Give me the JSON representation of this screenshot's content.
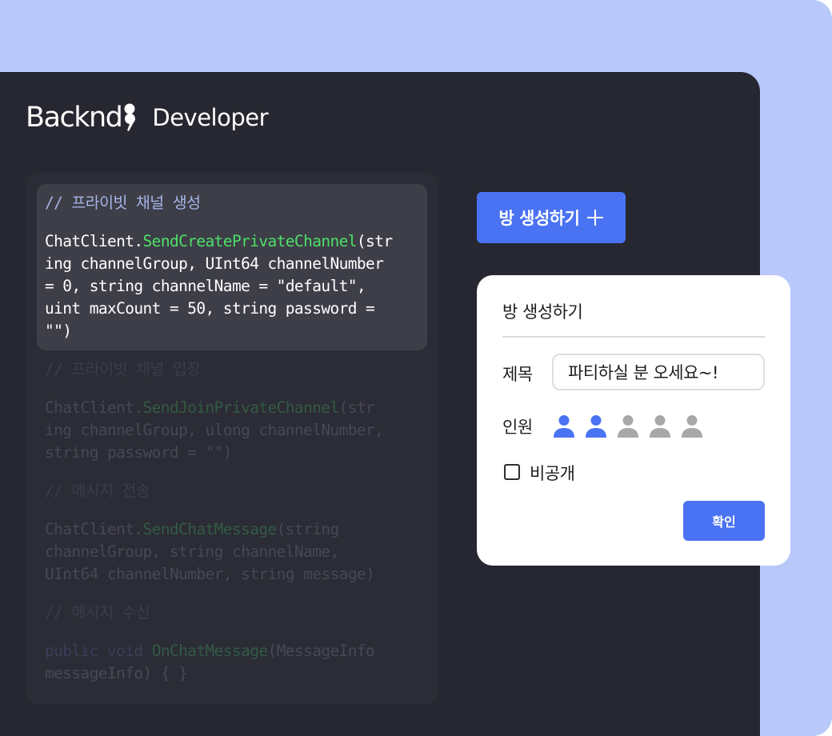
{
  "brand": {
    "name": "Backnd",
    "product": "Developer"
  },
  "code": {
    "create": {
      "comment": "// 프라이빗 채널 생성",
      "prefix": "ChatClient.",
      "method": "SendCreatePrivateChannel",
      "rest_line1": "(str",
      "lines": [
        "ing channelGroup, UInt64 channelNumber",
        "= 0, string channelName = \"default\",",
        "uint maxCount = 50, string password =",
        "\"\")"
      ]
    },
    "join": {
      "comment": "// 프라이빗 채널 입장",
      "prefix": "ChatClient.",
      "method": "SendJoinPrivateChannel",
      "rest_line1": "(str",
      "lines": [
        "ing channelGroup, ulong channelNumber,",
        "string password = \"\")"
      ]
    },
    "send": {
      "comment": "// 메시지 전송",
      "prefix": "ChatClient.",
      "method": "SendChatMessage",
      "rest_line1": "(string",
      "lines": [
        "channelGroup, string channelName,",
        "UInt64 channelNumber, string message)"
      ]
    },
    "receive": {
      "comment": "// 메시지 수신",
      "keyword": "public void ",
      "method": "OnChatMessage",
      "rest_line1": "(MessageInfo",
      "lines": [
        "messageInfo) { }"
      ]
    }
  },
  "create_room_button": {
    "label": "방 생성하기",
    "icon": "plus-icon"
  },
  "dialog": {
    "title": "방 생성하기",
    "title_field_label": "제목",
    "title_value": "파티하실 분 오세요~!",
    "members_label": "인원",
    "members_selected": 2,
    "members_max": 5,
    "private_label": "비공개",
    "private_checked": false,
    "confirm_label": "확인"
  },
  "colors": {
    "background_accent": "#b9c8fb",
    "panel": "#262730",
    "primary": "#4a73f3",
    "code_function": "#4ee06a",
    "code_comment": "#a5b4e6",
    "person_active": "#4a73f3",
    "person_inactive": "#a8a8a8"
  }
}
